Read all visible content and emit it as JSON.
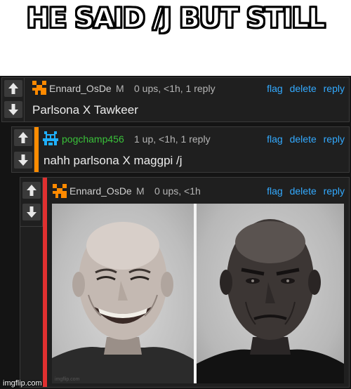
{
  "caption": {
    "text": "HE SAID /J BUT STILL"
  },
  "comments": [
    {
      "username": "Ennard_OsDe",
      "badge": "M",
      "meta": "0 ups, <1h, 1 reply",
      "actions": [
        "flag",
        "delete",
        "reply"
      ],
      "text": "Parlsona X Tawkeer",
      "username_color": "#d0d0d0",
      "accent_color": null,
      "avatar_icon": "orange-pixel-avatar-icon"
    },
    {
      "username": "pogchamp456",
      "badge": "",
      "meta": "1 up, <1h, 1 reply",
      "actions": [
        "flag",
        "delete",
        "reply"
      ],
      "text": "nahh parlsona X maggpi /j",
      "username_color": "#3ac13a",
      "accent_color": "#ff8c00",
      "avatar_icon": "blue-pixel-avatar-icon"
    },
    {
      "username": "Ennard_OsDe",
      "badge": "M",
      "meta": "0 ups, <1h",
      "actions": [
        "flag",
        "delete",
        "reply"
      ],
      "text": "",
      "username_color": "#d0d0d0",
      "accent_color": "#e03030",
      "avatar_icon": "orange-pixel-avatar-icon",
      "image": {
        "panels": [
          "smiling-bald-man",
          "frowning-bald-man"
        ],
        "inner_watermark": "imgflip.com"
      }
    }
  ],
  "watermark": "imgflip.com"
}
